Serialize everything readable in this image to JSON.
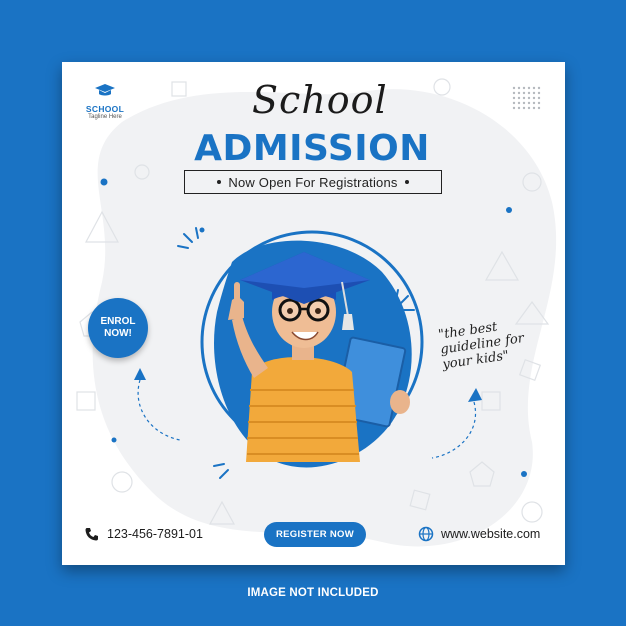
{
  "logo": {
    "name": "SCHOOL",
    "tagline": "Tagline Here"
  },
  "header": {
    "script_title": "School",
    "main_title": "ADMISSION",
    "subtitle": "Now Open For Registrations"
  },
  "badge": {
    "line1": "ENROL",
    "line2": "NOW!"
  },
  "tagline": {
    "line1": "\"the best",
    "line2": "guideline for",
    "line3": "your kids\""
  },
  "contact": {
    "phone": "123-456-7891-01",
    "website": "www.website.com"
  },
  "cta": {
    "register_label": "REGISTER NOW"
  },
  "footer": {
    "note": "IMAGE NOT INCLUDED"
  },
  "colors": {
    "brand_blue": "#1a73c4",
    "frame_blue": "#1a73c4",
    "shirt_yellow": "#f2a93b"
  },
  "icons": [
    "graduation-cap-icon",
    "dot-grid-icon",
    "phone-icon",
    "globe-icon",
    "arrow-icon"
  ]
}
